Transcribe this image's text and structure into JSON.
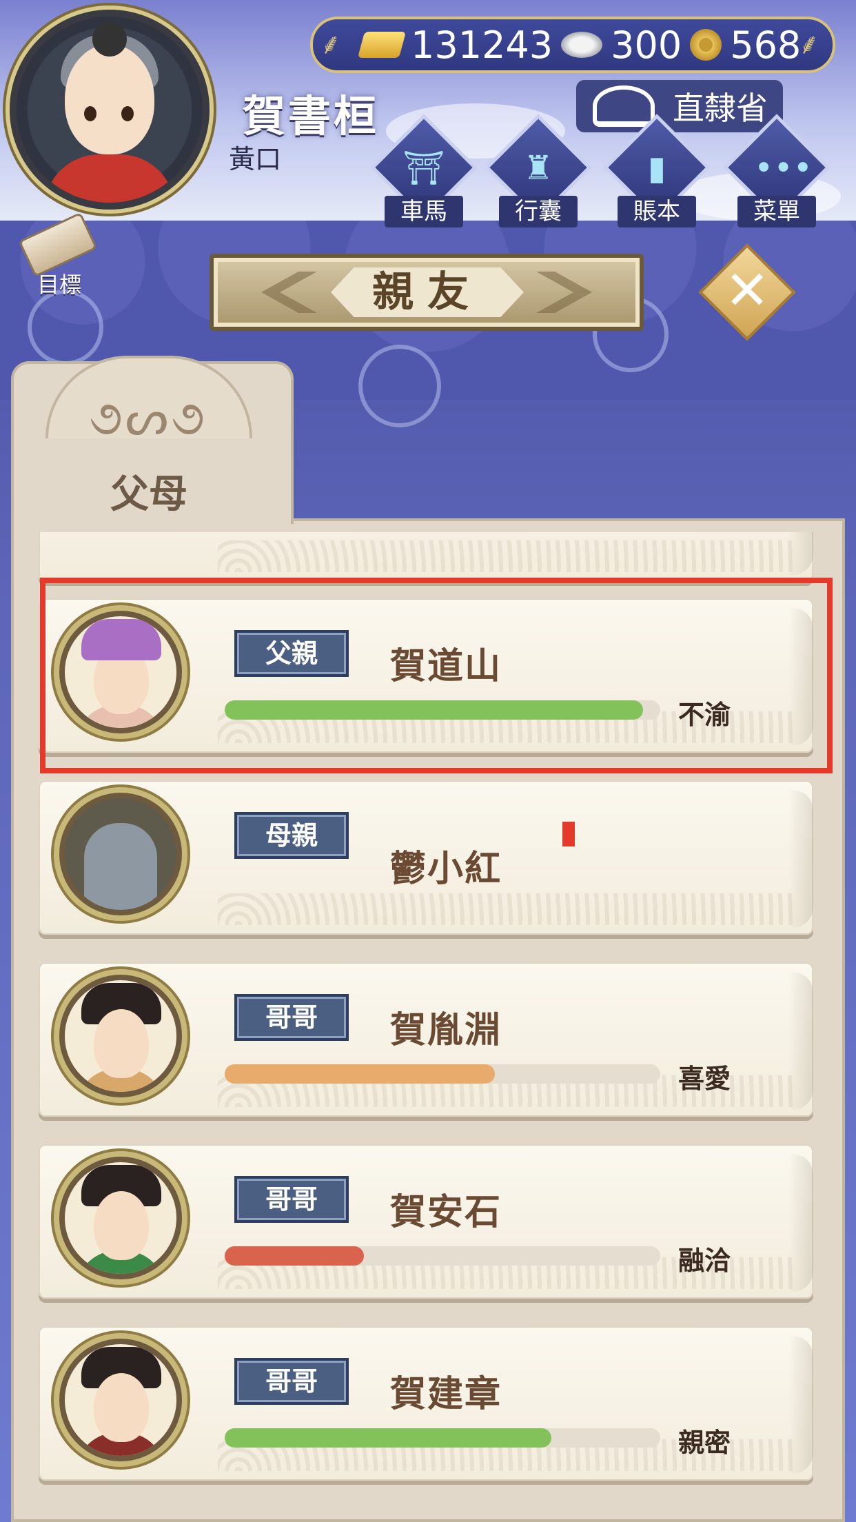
{
  "player": {
    "name": "賀書桓",
    "title": "黃口"
  },
  "currency": {
    "gold": "131243",
    "silver": "300",
    "copper": "568"
  },
  "province": {
    "label": "直隸省"
  },
  "menu": [
    {
      "label": "車馬",
      "icon": "carriage-icon"
    },
    {
      "label": "行囊",
      "icon": "bag-icon"
    },
    {
      "label": "賬本",
      "icon": "ledger-icon"
    },
    {
      "label": "菜單",
      "icon": "more-icon"
    }
  ],
  "goal": {
    "label": "目標"
  },
  "panel": {
    "title": "親友"
  },
  "tabs": [
    {
      "label": "父母"
    }
  ],
  "relatives": [
    {
      "relation": "父親",
      "name": "賀道山",
      "mood": "不渝",
      "bar_fraction": 0.96,
      "bar_color": "#83c25a",
      "portrait": "father"
    },
    {
      "relation": "母親",
      "name": "鬱小紅",
      "mood": "",
      "bar_fraction": null,
      "bar_color": "",
      "portrait": "tombstone"
    },
    {
      "relation": "哥哥",
      "name": "賀胤淵",
      "mood": "喜愛",
      "bar_fraction": 0.62,
      "bar_color": "#e8ab6c",
      "portrait": "brother1"
    },
    {
      "relation": "哥哥",
      "name": "賀安石",
      "mood": "融洽",
      "bar_fraction": 0.32,
      "bar_color": "#d9634c",
      "portrait": "brother2"
    },
    {
      "relation": "哥哥",
      "name": "賀建章",
      "mood": "親密",
      "bar_fraction": 0.75,
      "bar_color": "#83c25a",
      "portrait": "brother3"
    }
  ],
  "colors": {
    "highlight": "#e43a2b",
    "badge_bg": "#4b5f82",
    "name_text": "#6a4a32"
  }
}
